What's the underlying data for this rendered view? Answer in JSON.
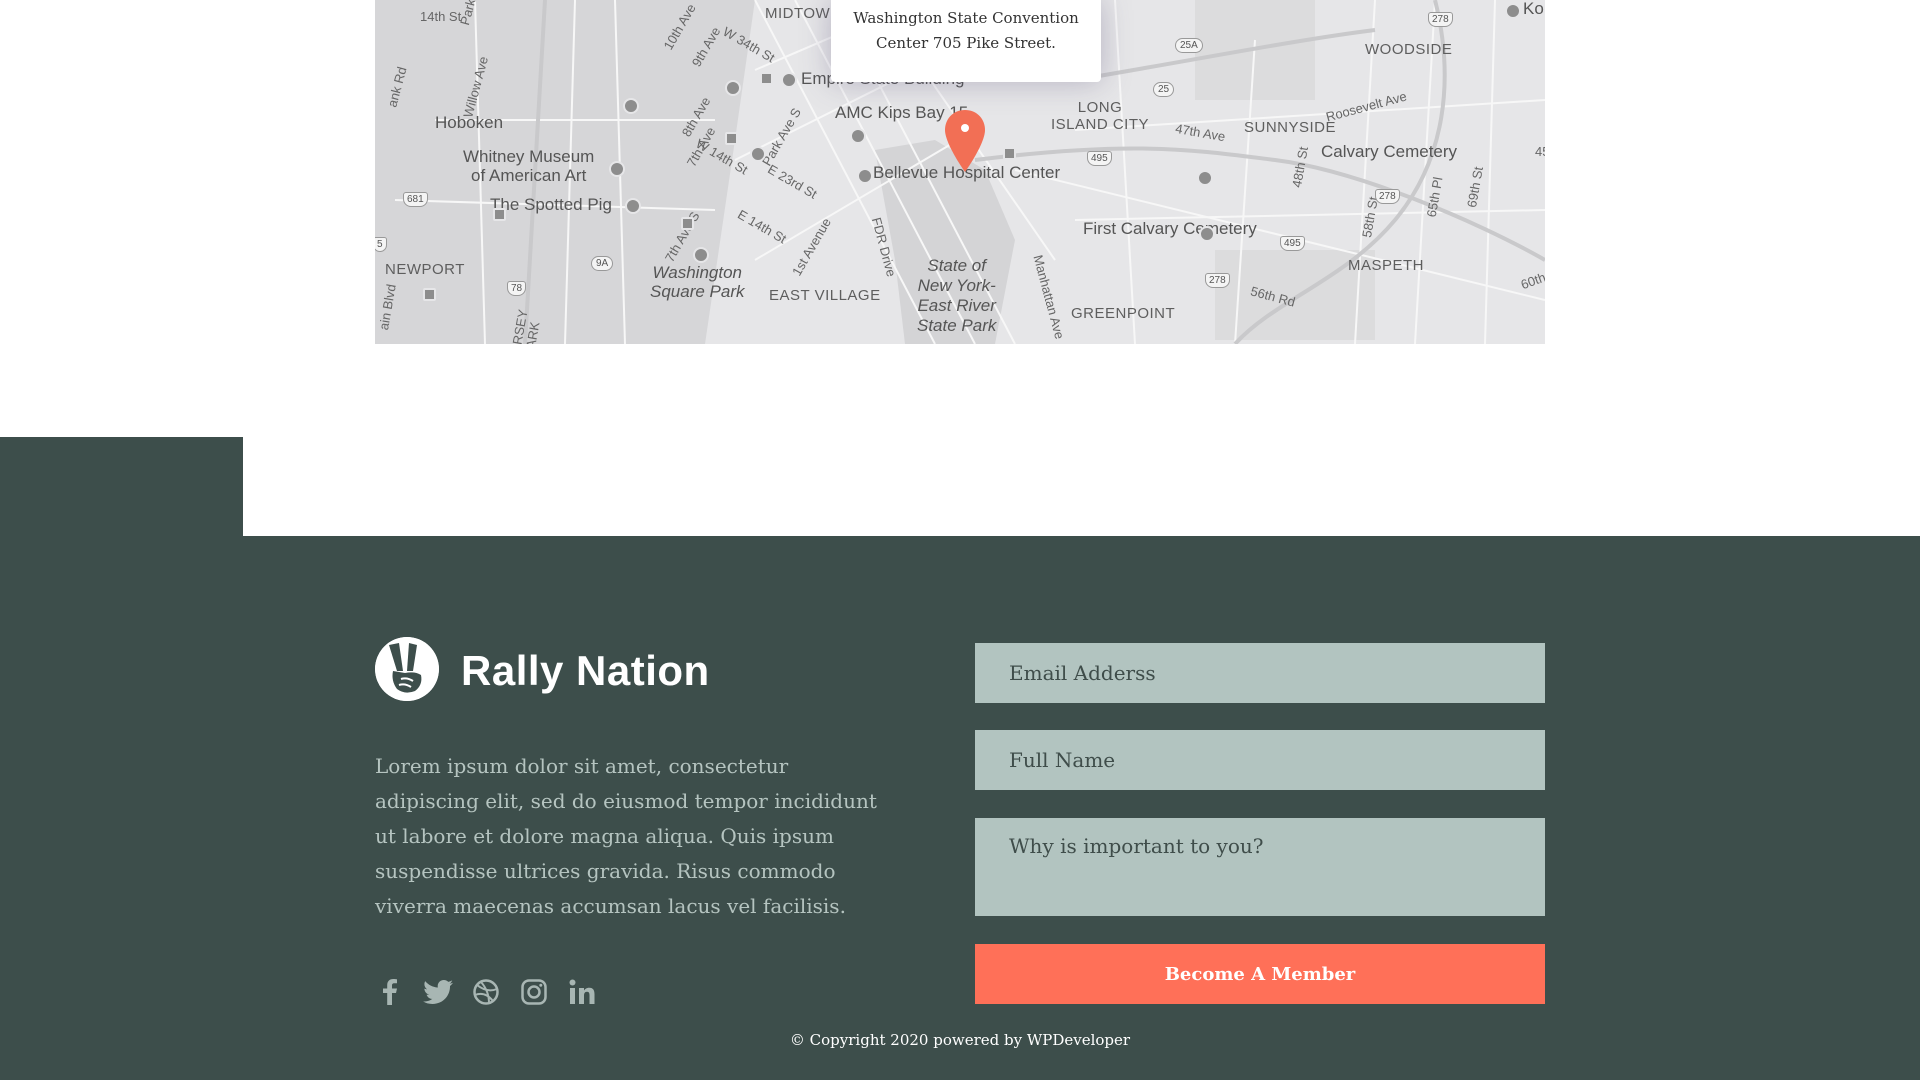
{
  "map": {
    "popup_address": "Washington State Convention Center 705 Pike Street.",
    "marker_color": "#f26f55",
    "labels": {
      "midtown": "MIDTOWN",
      "empire": "Empire State Building",
      "amc": "AMC Kips Bay 15",
      "bellevue": "Bellevue Hospital Center",
      "hoboken": "Hoboken",
      "whitney": "Whitney Museum\nof American Art",
      "spotted_pig": "The Spotted Pig",
      "newport": "NEWPORT",
      "washington_sq": "Washington\nSquare Park",
      "east_village": "EAST VILLAGE",
      "state_park": "State of\nNew York-\nEast River\nState Park",
      "greenpoint": "GREENPOINT",
      "first_calvary": "First Calvary Cemetery",
      "long_island": "LONG\nISLAND CITY",
      "sunnyside": "SUNNYSIDE",
      "woodside": "WOODSIDE",
      "calvary": "Calvary Cemetery",
      "maspeth": "MASPETH",
      "ko": "Ko",
      "s14th": "14th St",
      "willow": "Willow Ave",
      "park_ave_nj": "Park",
      "ank_rd": "ank Rd",
      "tenth_ave": "10th Ave",
      "ninth_ave": "9th Ave",
      "w34": "W 34th St",
      "eighth_ave": "8th Ave",
      "w14": "W 14th St",
      "seventh_ave": "7th Ave",
      "park_ave_s": "Park Ave S",
      "e23": "E 23rd St",
      "e14": "E 14th St",
      "seventh_ave_s": "7th Ave S",
      "first_ave": "1st Avenue",
      "fdr": "FDR Drive",
      "manhattan_ave": "Manhattan Ave",
      "forty_seventh": "47th Ave",
      "roosevelt": "Roosevelt Ave",
      "forty_fifth": "45th Av",
      "forty_eighth": "48th St",
      "fifty_eighth": "58th St",
      "sixty_fifth_pl": "65th Pl",
      "sixty_ninth": "69th St",
      "fifty_sixth": "56th Rd",
      "sixtieth": "60th Ave",
      "jersey": "RSEY",
      "ark": "ARK",
      "blvd": "ain Blvd"
    },
    "shields": {
      "s278a": "278",
      "s25a": "25A",
      "s25": "25",
      "s495a": "495",
      "s681": "681",
      "s78": "78",
      "s9a": "9A",
      "s278b": "278",
      "s495b": "495",
      "s278c": "278",
      "s5": "5"
    }
  },
  "brand": {
    "name": "Rally Nation",
    "logo_icon": "peace-hand-icon"
  },
  "about_text": "Lorem ipsum dolor sit amet, consectetur adipiscing elit, sed do eiusmod tempor incididunt ut labore et dolore magna aliqua. Quis ipsum suspendisse ultrices gravida. Risus commodo viverra maecenas accumsan lacus vel facilisis.",
  "social_icons": [
    "facebook-icon",
    "twitter-icon",
    "dribbble-icon",
    "instagram-icon",
    "linkedin-icon"
  ],
  "form": {
    "email_placeholder": "Email Adderss",
    "name_placeholder": "Full Name",
    "why_placeholder": "Why is important to you?",
    "submit_label": "Become A Member"
  },
  "copyright": "© Copyright 2020 powered by WPDeveloper",
  "colors": {
    "footer_bg": "#3d4e4b",
    "field_bg": "#b2c4c0",
    "cta_bg": "#ff7058",
    "text_muted": "#b5c4c0"
  }
}
